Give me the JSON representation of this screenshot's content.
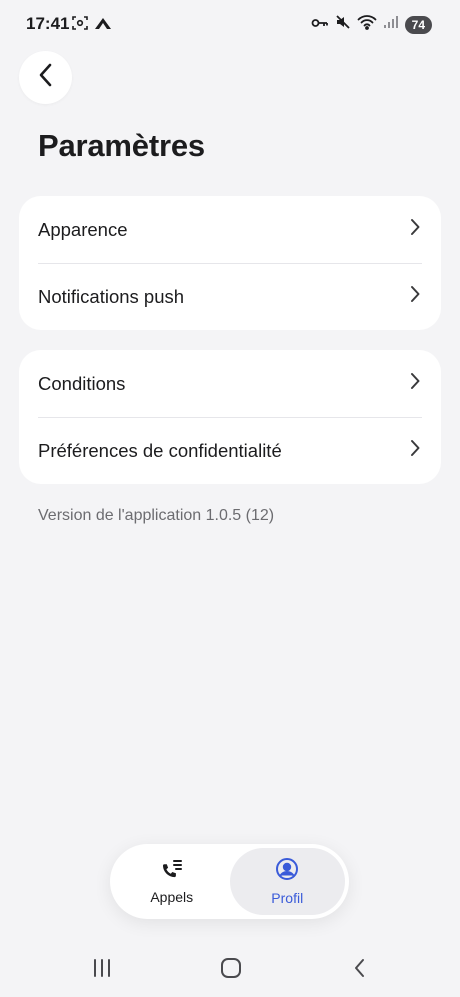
{
  "status_bar": {
    "time": "17:41",
    "battery": "74",
    "icons": [
      "screenshot-icon",
      "mountain-icon",
      "key-icon",
      "mute-icon",
      "wifi-icon",
      "signal-icon"
    ]
  },
  "header": {
    "back_icon": "chevron-left-icon",
    "title": "Paramètres"
  },
  "settings_groups": [
    {
      "items": [
        {
          "label": "Apparence"
        },
        {
          "label": "Notifications push"
        }
      ]
    },
    {
      "items": [
        {
          "label": "Conditions"
        },
        {
          "label": "Préférences de confidentialité"
        }
      ]
    }
  ],
  "version_text": "Version de l'application 1.0.5 (12)",
  "tab_bar": {
    "tabs": [
      {
        "label": "Appels",
        "icon": "phone-list-icon",
        "active": false
      },
      {
        "label": "Profil",
        "icon": "profile-icon",
        "active": true
      }
    ],
    "accent": "#3a5bd9"
  },
  "system_nav": [
    "recent-apps-icon",
    "home-icon",
    "back-icon"
  ]
}
